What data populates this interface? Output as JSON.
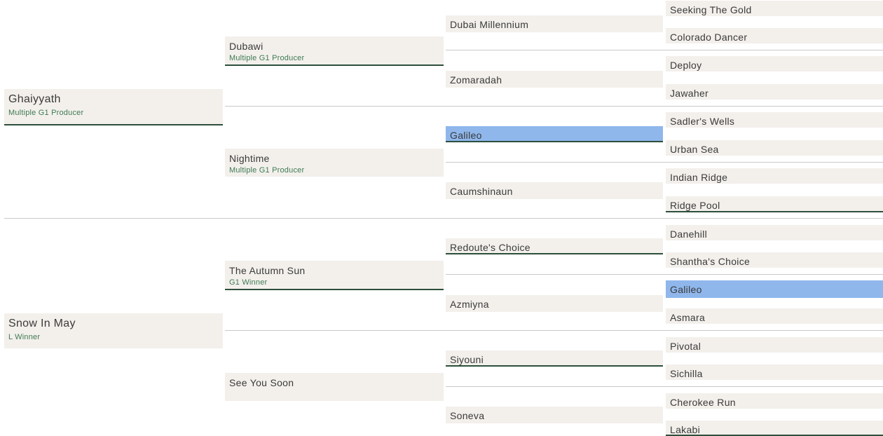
{
  "pedigree": {
    "gen1": [
      {
        "name": "Ghaiyyath",
        "sub": "Multiple G1 Producer"
      },
      {
        "name": "Snow In May",
        "sub": "L Winner"
      }
    ],
    "gen2": [
      {
        "name": "Dubawi",
        "sub": "Multiple G1 Producer"
      },
      {
        "name": "Nightime",
        "sub": "Multiple G1 Producer"
      },
      {
        "name": "The Autumn Sun",
        "sub": "G1 Winner"
      },
      {
        "name": "See You Soon",
        "sub": ""
      }
    ],
    "gen3": [
      {
        "name": "Dubai Millennium"
      },
      {
        "name": "Zomaradah"
      },
      {
        "name": "Galileo"
      },
      {
        "name": "Caumshinaun"
      },
      {
        "name": "Redoute's Choice"
      },
      {
        "name": "Azmiyna"
      },
      {
        "name": "Siyouni"
      },
      {
        "name": "Soneva"
      }
    ],
    "gen4": [
      {
        "name": "Seeking The Gold"
      },
      {
        "name": "Colorado Dancer"
      },
      {
        "name": "Deploy"
      },
      {
        "name": "Jawaher"
      },
      {
        "name": "Sadler's Wells"
      },
      {
        "name": "Urban Sea"
      },
      {
        "name": "Indian Ridge"
      },
      {
        "name": "Ridge Pool"
      },
      {
        "name": "Danehill"
      },
      {
        "name": "Shantha's Choice"
      },
      {
        "name": "Galileo"
      },
      {
        "name": "Asmara"
      },
      {
        "name": "Pivotal"
      },
      {
        "name": "Sichilla"
      },
      {
        "name": "Cherokee Run"
      },
      {
        "name": "Lakabi"
      }
    ]
  },
  "colors": {
    "box_background": "#f3f0ec",
    "highlight": "#8fb7ec",
    "underline": "#2d4f3c",
    "subtitle_text": "#3f7a53",
    "divider": "#c9c9c9"
  }
}
